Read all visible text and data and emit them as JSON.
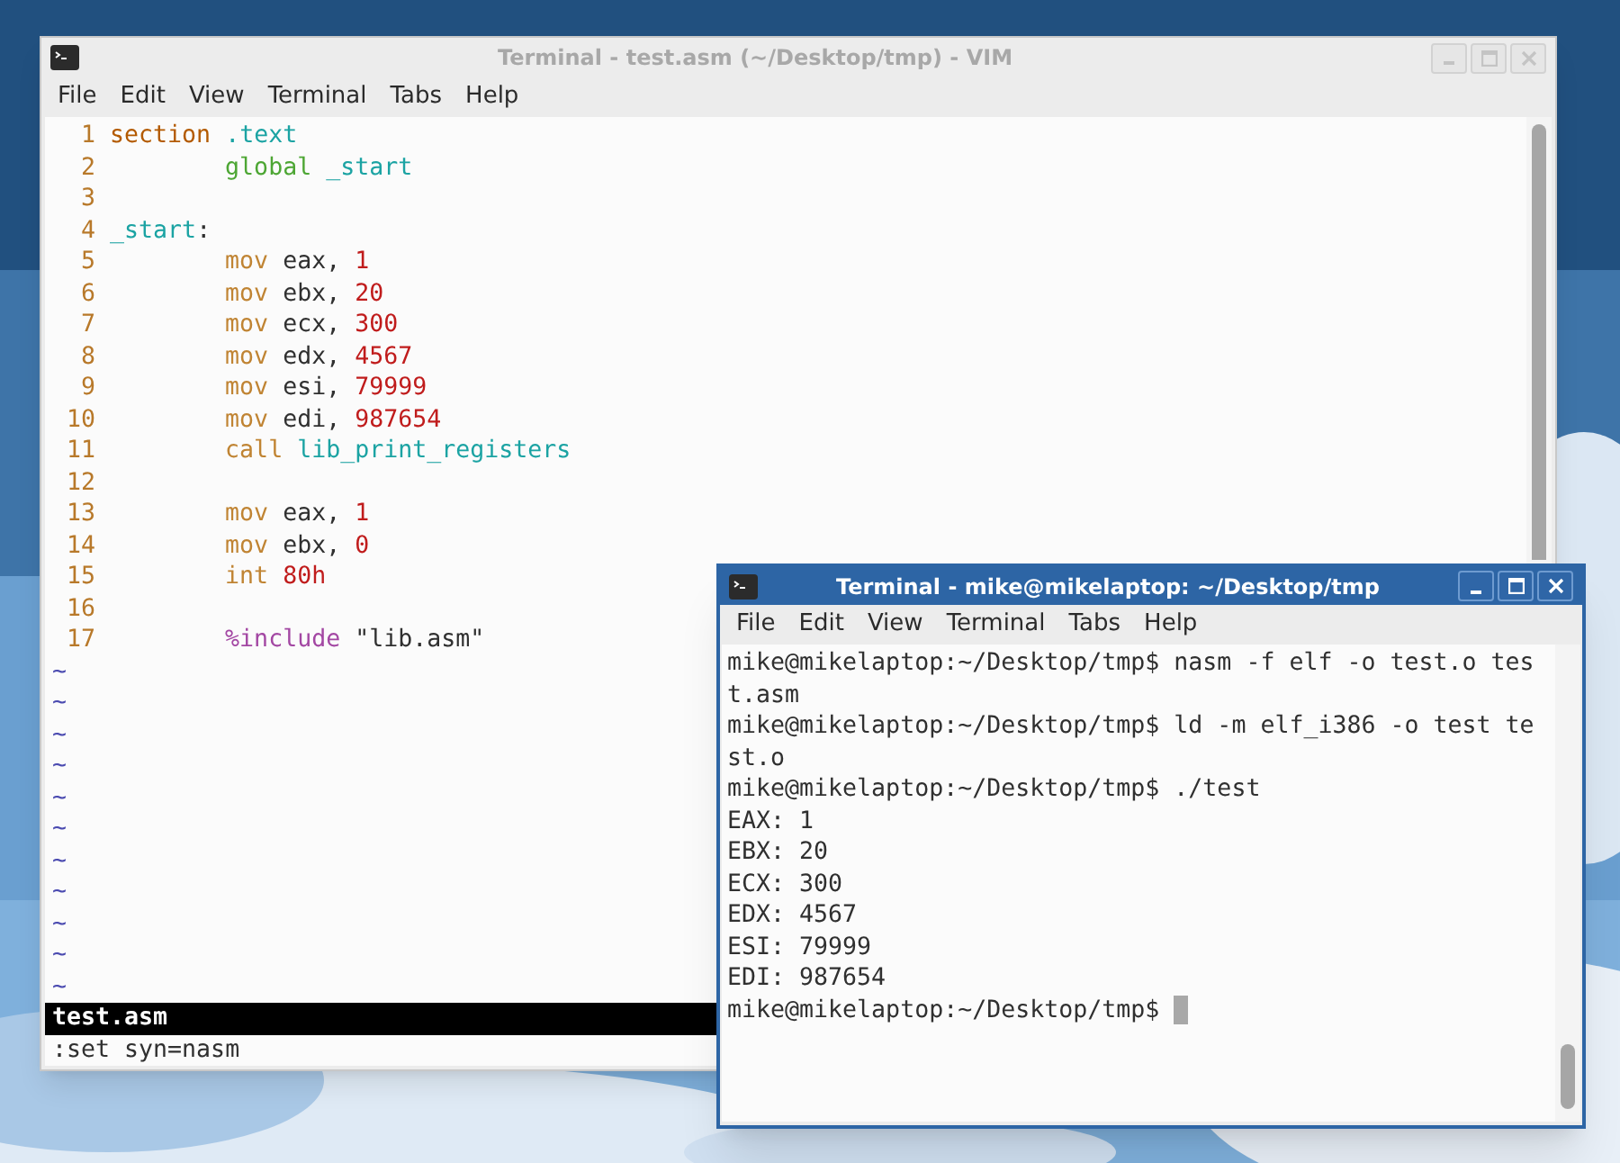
{
  "vim_window": {
    "title": "Terminal - test.asm (~/Desktop/tmp) - VIM",
    "active": false,
    "menu": [
      "File",
      "Edit",
      "View",
      "Terminal",
      "Tabs",
      "Help"
    ],
    "lines": [
      {
        "number": "1",
        "indented": false,
        "tokens": [
          {
            "text": "section",
            "kind": "keyword"
          },
          {
            "text": " .text",
            "kind": "identifier"
          }
        ]
      },
      {
        "number": "2",
        "indented": true,
        "tokens": [
          {
            "text": "global",
            "kind": "directive"
          },
          {
            "text": " _start",
            "kind": "identifier"
          }
        ]
      },
      {
        "number": "3"
      },
      {
        "number": "4",
        "indented": false,
        "tokens": [
          {
            "text": "_start",
            "kind": "identifier"
          },
          {
            "text": ":",
            "kind": "plain"
          }
        ]
      },
      {
        "number": "5",
        "indented": true,
        "tokens": [
          {
            "text": "mov",
            "kind": "instruction"
          },
          {
            "text": " eax, ",
            "kind": "plain"
          },
          {
            "text": "1",
            "kind": "number"
          }
        ]
      },
      {
        "number": "6",
        "indented": true,
        "tokens": [
          {
            "text": "mov",
            "kind": "instruction"
          },
          {
            "text": " ebx, ",
            "kind": "plain"
          },
          {
            "text": "20",
            "kind": "number"
          }
        ]
      },
      {
        "number": "7",
        "indented": true,
        "tokens": [
          {
            "text": "mov",
            "kind": "instruction"
          },
          {
            "text": " ecx, ",
            "kind": "plain"
          },
          {
            "text": "300",
            "kind": "number"
          }
        ]
      },
      {
        "number": "8",
        "indented": true,
        "tokens": [
          {
            "text": "mov",
            "kind": "instruction"
          },
          {
            "text": " edx, ",
            "kind": "plain"
          },
          {
            "text": "4567",
            "kind": "number"
          }
        ]
      },
      {
        "number": "9",
        "indented": true,
        "tokens": [
          {
            "text": "mov",
            "kind": "instruction"
          },
          {
            "text": " esi, ",
            "kind": "plain"
          },
          {
            "text": "79999",
            "kind": "number"
          }
        ]
      },
      {
        "number": "10",
        "indented": true,
        "tokens": [
          {
            "text": "mov",
            "kind": "instruction"
          },
          {
            "text": " edi, ",
            "kind": "plain"
          },
          {
            "text": "987654",
            "kind": "number"
          }
        ]
      },
      {
        "number": "11",
        "indented": true,
        "tokens": [
          {
            "text": "call",
            "kind": "instruction"
          },
          {
            "text": " lib_print_registers",
            "kind": "identifier"
          }
        ]
      },
      {
        "number": "12"
      },
      {
        "number": "13",
        "indented": true,
        "tokens": [
          {
            "text": "mov",
            "kind": "instruction"
          },
          {
            "text": " eax, ",
            "kind": "plain"
          },
          {
            "text": "1",
            "kind": "number"
          }
        ]
      },
      {
        "number": "14",
        "indented": true,
        "tokens": [
          {
            "text": "mov",
            "kind": "instruction"
          },
          {
            "text": " ebx, ",
            "kind": "plain"
          },
          {
            "text": "0",
            "kind": "number"
          }
        ]
      },
      {
        "number": "15",
        "indented": true,
        "tokens": [
          {
            "text": "int",
            "kind": "instruction"
          },
          {
            "text": " 80h",
            "kind": "number"
          }
        ]
      },
      {
        "number": "16"
      },
      {
        "number": "17",
        "indented": true,
        "tokens": [
          {
            "text": "%include",
            "kind": "preprocessor"
          },
          {
            "text": " \"lib.asm\"",
            "kind": "plain"
          }
        ]
      }
    ],
    "empty_line_markers": [
      "~",
      "~",
      "~",
      "~",
      "~",
      "~",
      "~",
      "~",
      "~",
      "~",
      "~"
    ],
    "status_line": "test.asm",
    "command_line": ":set syn=nasm"
  },
  "terminal_window": {
    "title": "Terminal - mike@mikelaptop: ~/Desktop/tmp",
    "active": true,
    "menu": [
      "File",
      "Edit",
      "View",
      "Terminal",
      "Tabs",
      "Help"
    ],
    "lines": [
      "mike@mikelaptop:~/Desktop/tmp$ nasm -f elf -o test.o tes",
      "t.asm",
      "mike@mikelaptop:~/Desktop/tmp$ ld -m elf_i386 -o test te",
      "st.o",
      "mike@mikelaptop:~/Desktop/tmp$ ./test",
      "EAX: 1",
      "EBX: 20",
      "ECX: 300",
      "EDX: 4567",
      "ESI: 79999",
      "EDI: 987654",
      "mike@mikelaptop:~/Desktop/tmp$ "
    ]
  }
}
